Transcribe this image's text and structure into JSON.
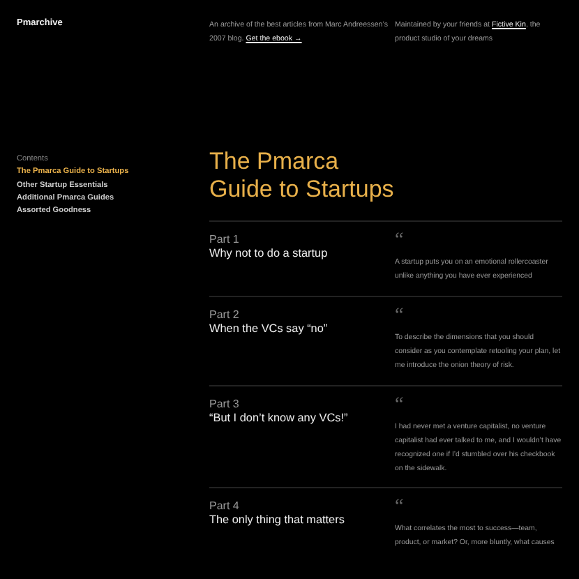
{
  "header": {
    "logo": "Pmarchive",
    "about": "An archive of the best articles from Marc Andreessen’s 2007 blog.",
    "ebook_link": "Get the ebook →",
    "maintained": "Maintained by your friends at",
    "studio_link": "Fictive Kin",
    "maintained_tail": ", the product studio of your dreams"
  },
  "sidebar": {
    "heading": "Contents",
    "items": [
      {
        "label": "The Pmarca Guide to Startups",
        "selected": true
      },
      {
        "label": "Other Startup Essentials",
        "selected": false
      },
      {
        "label": "Additional Pmarca Guides",
        "selected": false
      },
      {
        "label": "Assorted Goodness",
        "selected": false
      }
    ]
  },
  "title": "The Pmarca Guide to Startups",
  "parts": [
    {
      "part": "Part 1",
      "title": "Why not to do a startup",
      "quote_mark": "“",
      "excerpt": "A startup puts you on an emotional rollercoaster unlike anything you have ever experienced"
    },
    {
      "part": "Part 2",
      "title": "When the VCs say “no”",
      "quote_mark": "“",
      "excerpt": "To describe the dimensions that you should consider as you contemplate retooling your plan, let me introduce the onion theory of risk."
    },
    {
      "part": "Part 3",
      "title": "“But I don’t know any VCs!”",
      "quote_mark": "“",
      "excerpt": "I had never met a venture capitalist, no venture capitalist had ever talked to me, and I wouldn’t have recognized one if I’d stumbled over his checkbook on the sidewalk."
    },
    {
      "part": "Part 4",
      "title": "The only thing that matters",
      "quote_mark": "“",
      "excerpt": "What correlates the most to success—team, product, or market? Or, more bluntly, what causes"
    }
  ]
}
